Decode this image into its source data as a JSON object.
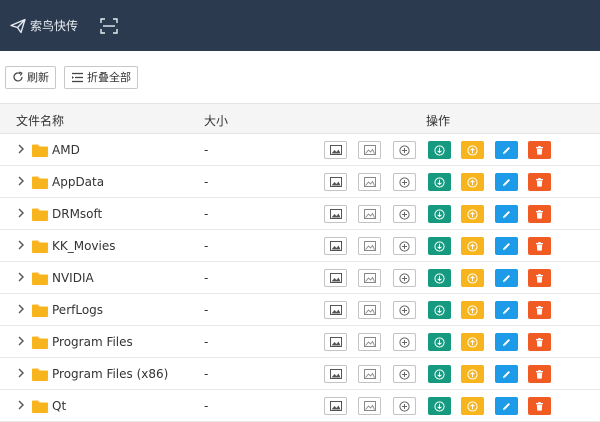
{
  "header": {
    "brand": "索鸟快传",
    "brand_icon": "paper-plane-icon",
    "scan_icon": "scan-icon"
  },
  "toolbar": {
    "refresh_label": "刷新",
    "collapse_label": "折叠全部"
  },
  "table": {
    "col_name": "文件名称",
    "col_size": "大小",
    "col_actions": "操作",
    "rows": [
      {
        "name": "AMD",
        "size": "-"
      },
      {
        "name": "AppData",
        "size": "-"
      },
      {
        "name": "DRMsoft",
        "size": "-"
      },
      {
        "name": "KK_Movies",
        "size": "-"
      },
      {
        "name": "NVIDIA",
        "size": "-"
      },
      {
        "name": "PerfLogs",
        "size": "-"
      },
      {
        "name": "Program Files",
        "size": "-"
      },
      {
        "name": "Program Files (x86)",
        "size": "-"
      },
      {
        "name": "Qt",
        "size": "-"
      }
    ]
  },
  "colors": {
    "header_bg": "#2b3a4f",
    "folder": "#f7b41c",
    "download": "#159a80",
    "upload": "#f7b41c",
    "edit": "#1e9be8",
    "delete": "#f05a23"
  }
}
